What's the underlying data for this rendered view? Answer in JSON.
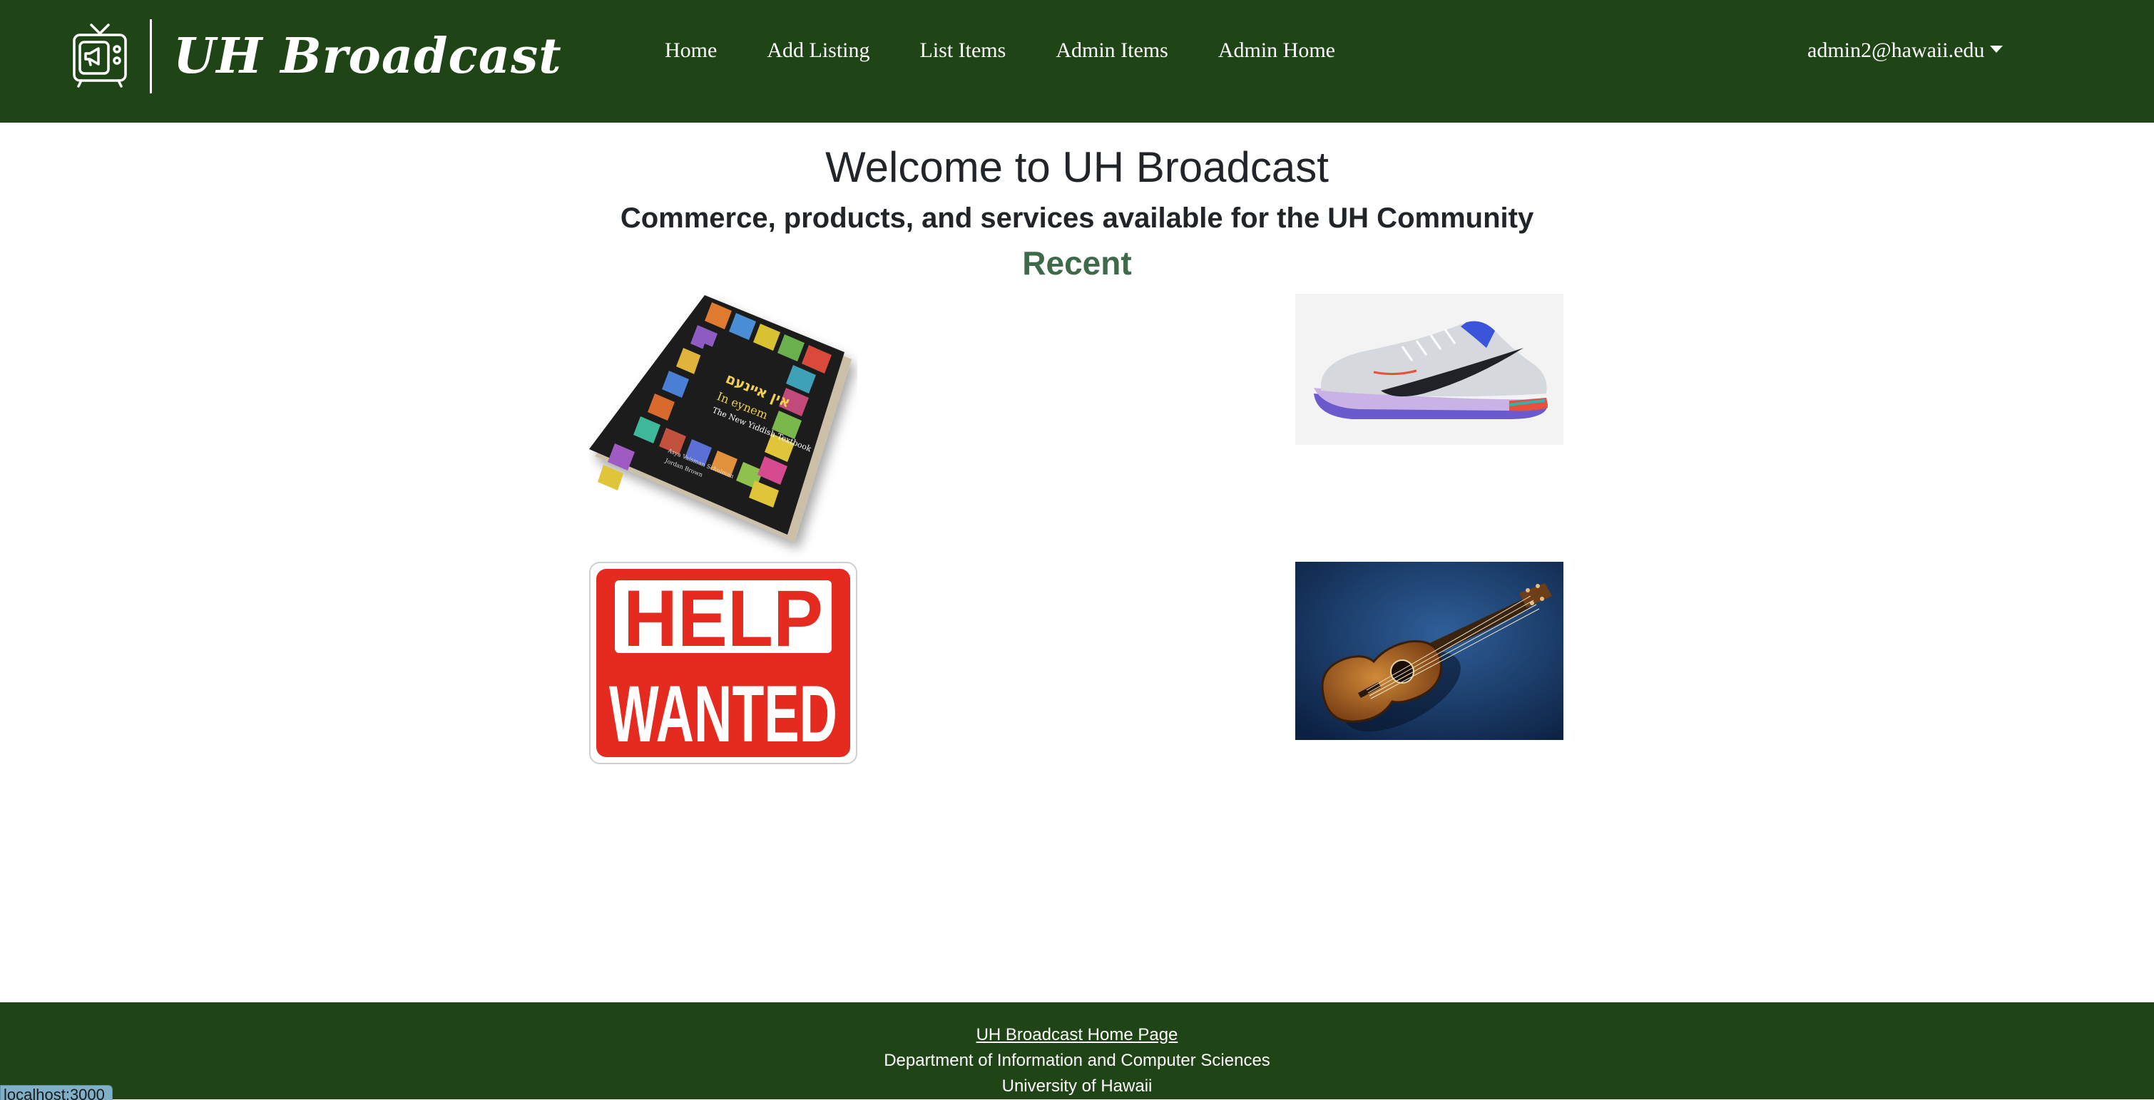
{
  "navbar": {
    "brand_text": "UH Broadcast",
    "links": [
      {
        "label": "Home"
      },
      {
        "label": "Add Listing"
      },
      {
        "label": "List Items"
      },
      {
        "label": "Admin Items"
      },
      {
        "label": "Admin Home"
      }
    ],
    "user_email": "admin2@hawaii.edu",
    "background_color": "#1f4516"
  },
  "main": {
    "title": "Welcome to UH Broadcast",
    "subtitle": "Commerce, products, and services available for the UH Community",
    "section_heading": "Recent",
    "items": [
      {
        "icon": "textbook-image"
      },
      {
        "icon": "sneaker-image"
      },
      {
        "icon": "help-wanted-sign-image",
        "sign_line1": "HELP",
        "sign_line2": "WANTED"
      },
      {
        "icon": "ukulele-image"
      }
    ]
  },
  "footer": {
    "link_text": "UH Broadcast Home Page",
    "line1": "Department of Information and Computer Sciences",
    "line2": "University of Hawaii"
  },
  "status_bar": {
    "url": "localhost:3000"
  }
}
